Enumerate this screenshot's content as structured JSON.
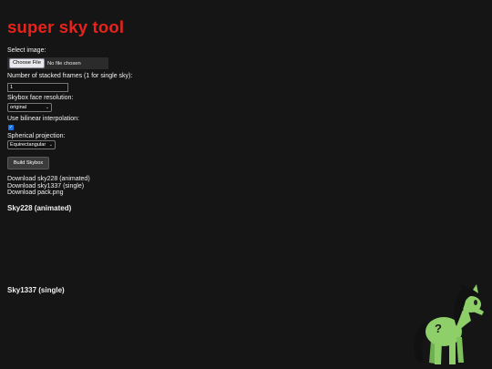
{
  "app": {
    "title": "super sky tool"
  },
  "select_image": {
    "label": "Select image:",
    "button_label": "Choose File",
    "status": "No file chosen"
  },
  "frames": {
    "label": "Number of stacked frames (1 for single sky):",
    "value": "1"
  },
  "face_resolution": {
    "label": "Skybox face resolution:",
    "selected": "original"
  },
  "bilinear": {
    "label": "Use bilinear interpolation:",
    "checked": true
  },
  "projection": {
    "label": "Spherical projection:",
    "selected": "Equirectangular"
  },
  "build_button": "Build Skybox",
  "downloads": [
    "Download sky228 (animated)",
    "Download sky1337 (single)",
    "Download pack.png"
  ],
  "sections": {
    "animated_heading": "Sky228 (animated)",
    "single_heading": "Sky1337 (single)"
  },
  "colors": {
    "background": "#151515",
    "title": "#e8231c",
    "mascot_body": "#8fcf6a",
    "mascot_hair": "#111111"
  },
  "icons": {
    "mascot": "pony-mascot-icon",
    "checkbox": "checkmark-icon",
    "select": "chevron-down-icon"
  }
}
